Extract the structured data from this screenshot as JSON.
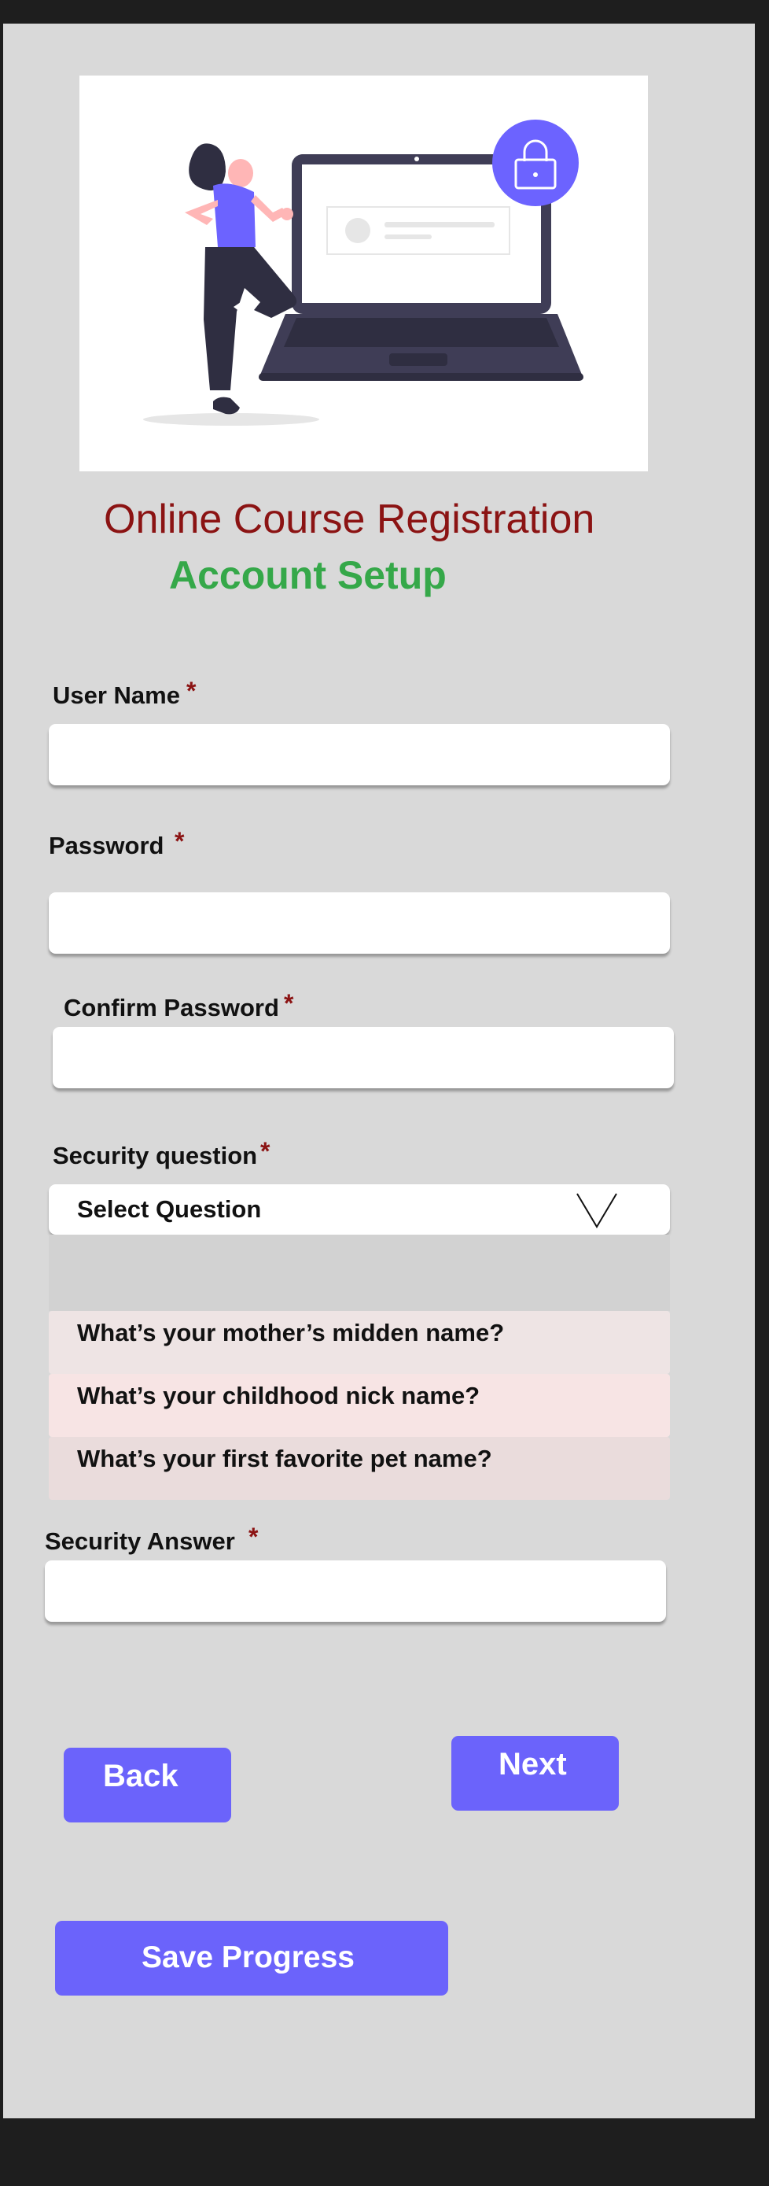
{
  "header": {
    "title": "Online Course Registration",
    "subtitle": "Account Setup"
  },
  "hero": {
    "icon": "lock-icon",
    "accent_color": "#6c63ff"
  },
  "fields": {
    "username": {
      "label": "User Name",
      "required_mark": "*",
      "value": ""
    },
    "password": {
      "label": "Password",
      "required_mark": "*",
      "value": ""
    },
    "confirm_password": {
      "label": "Confirm Password",
      "required_mark": "*",
      "value": ""
    },
    "security_question": {
      "label": "Security question",
      "required_mark": "*",
      "selected": "Select Question",
      "options": [
        "What’s your mother’s midden name?",
        "What’s your childhood nick name?",
        "What’s your first favorite pet name?"
      ]
    },
    "security_answer": {
      "label": "Security Answer",
      "required_mark": "*",
      "value": ""
    }
  },
  "buttons": {
    "back": "Back",
    "next": "Next",
    "save": "Save Progress"
  },
  "colors": {
    "title": "#8b1313",
    "subtitle": "#35a849",
    "button": "#6b63fb",
    "background": "#d9d9d9"
  }
}
